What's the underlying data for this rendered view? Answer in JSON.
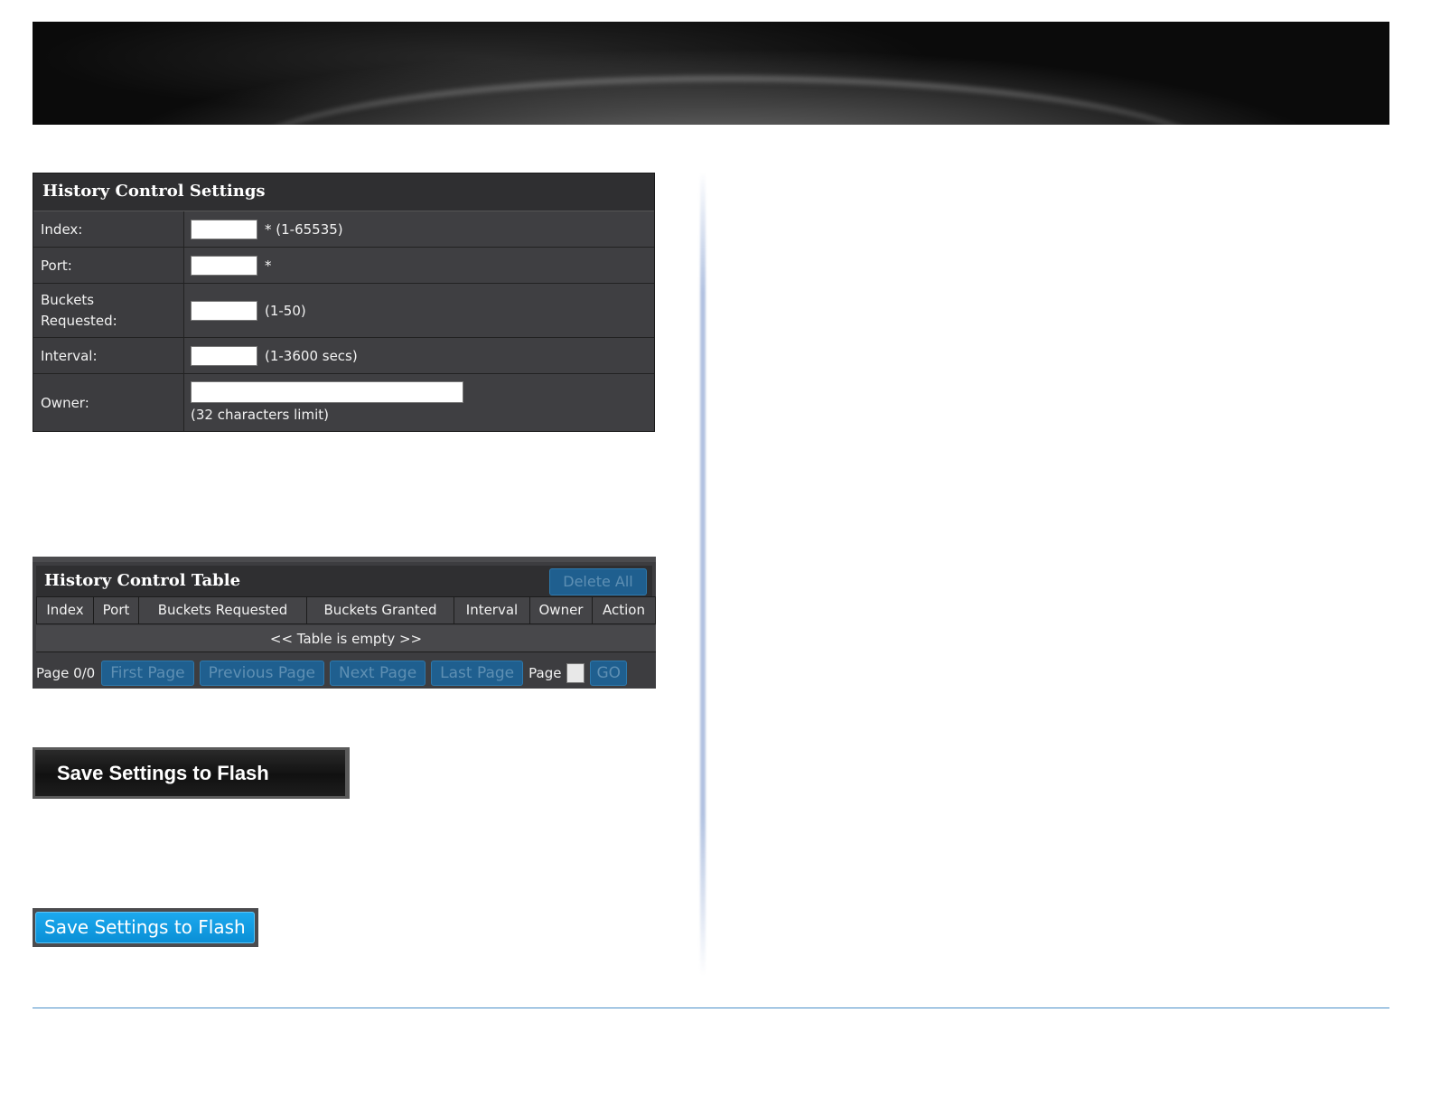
{
  "settings": {
    "title": "History Control Settings",
    "index_label": "Index:",
    "index_hint": "* (1-65535)",
    "index_value": "",
    "port_label": "Port:",
    "port_hint": "*",
    "port_value": "",
    "buckets_label_line1": "Buckets",
    "buckets_label_line2": "Requested:",
    "buckets_hint": "(1-50)",
    "buckets_value": "",
    "interval_label": "Interval:",
    "interval_hint": "(1-3600 secs)",
    "interval_value": "",
    "owner_label": "Owner:",
    "owner_hint": "(32 characters limit)",
    "owner_value": ""
  },
  "table": {
    "title": "History Control Table",
    "delete_all_label": "Delete All",
    "columns": [
      "Index",
      "Port",
      "Buckets Requested",
      "Buckets Granted",
      "Interval",
      "Owner",
      "Action"
    ],
    "empty_text": "<< Table is empty >>",
    "page_status": "Page 0/0",
    "first_page_label": "First Page",
    "previous_page_label": "Previous Page",
    "next_page_label": "Next Page",
    "last_page_label": "Last Page",
    "page_label": "Page",
    "page_value": "",
    "go_label": "GO"
  },
  "save_dark_label": "Save Settings to Flash",
  "save_blue_label": "Save Settings to Flash",
  "colors": {
    "panel_bg": "#3b3b3d",
    "button_blue": "#1ca9ee",
    "footer_line": "#4a8fc9"
  }
}
